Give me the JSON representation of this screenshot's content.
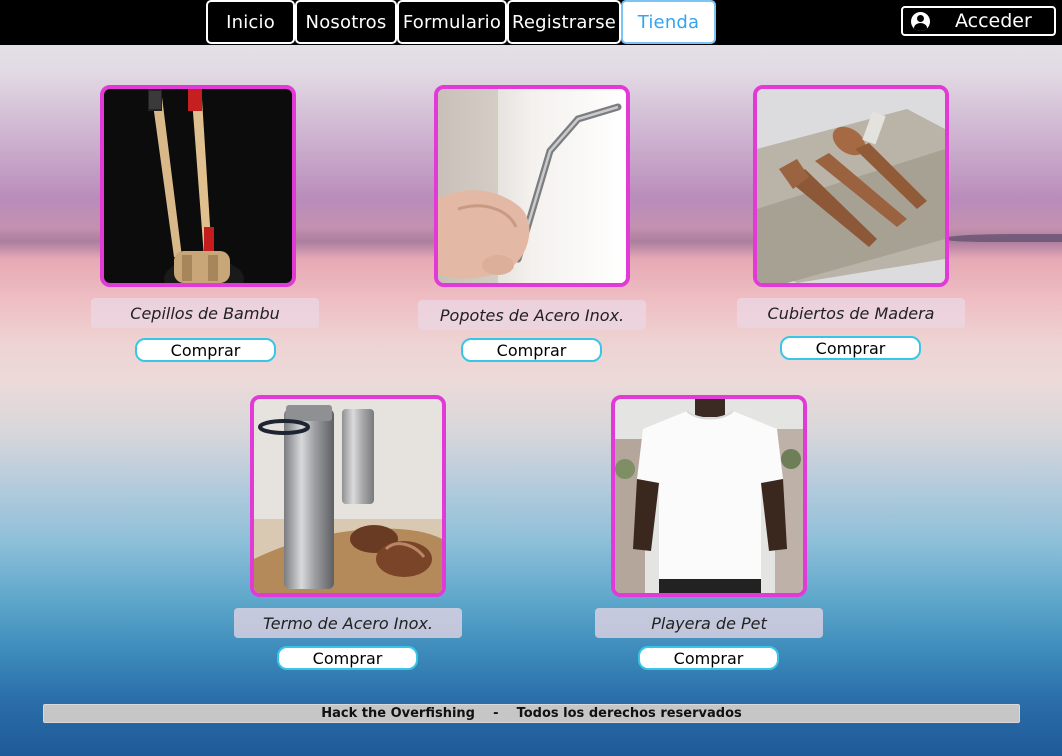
{
  "nav": {
    "items": [
      {
        "label": "Inicio",
        "active": false
      },
      {
        "label": "Nosotros",
        "active": false
      },
      {
        "label": "Formulario",
        "active": false
      },
      {
        "label": "Registrarse",
        "active": false
      },
      {
        "label": "Tienda",
        "active": true
      }
    ],
    "login_label": "Acceder",
    "login_icon": "user-circle-icon"
  },
  "products": [
    {
      "name": "Cepillos de Bambu",
      "buy_label": "Comprar",
      "image": "bamboo-toothbrushes"
    },
    {
      "name": "Popotes de Acero Inox.",
      "buy_label": "Comprar",
      "image": "steel-straw"
    },
    {
      "name": "Cubiertos de Madera",
      "buy_label": "Comprar",
      "image": "wooden-cutlery"
    },
    {
      "name": "Termo de Acero Inox.",
      "buy_label": "Comprar",
      "image": "steel-bottle"
    },
    {
      "name": "Playera de Pet",
      "buy_label": "Comprar",
      "image": "white-tshirt"
    }
  ],
  "footer": {
    "text": "Hack the Overfishing    -    Todos los derechos reservados"
  },
  "colors": {
    "card_border": "#e23ad6",
    "buy_border": "#39c6e6",
    "active_nav": "#35a3f0"
  }
}
